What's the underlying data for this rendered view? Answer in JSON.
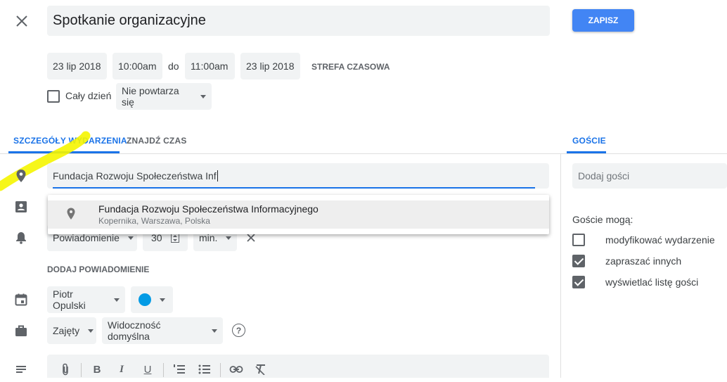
{
  "header": {
    "title_value": "Spotkanie organizacyjne",
    "save_label": "ZAPISZ"
  },
  "datetime": {
    "start_date": "23 lip 2018",
    "start_time": "10:00am",
    "separator": "do",
    "end_time": "11:00am",
    "end_date": "23 lip 2018",
    "timezone_label": "STREFA CZASOWA"
  },
  "options": {
    "all_day_label": "Cały dzień",
    "all_day_checked": false,
    "repeat_value": "Nie powtarza się"
  },
  "tabs": {
    "details": "SZCZEGÓŁY WYDARZENIA",
    "find_time": "ZNAJDŹ CZAS",
    "guests": "GOŚCIE"
  },
  "location": {
    "value": "Fundacja Rozwoju Społeczeństwa Inf",
    "suggestion_title": "Fundacja Rozwoju Społeczeństwa Informacyjnego",
    "suggestion_subtitle": "Kopernika, Warszawa, Polska"
  },
  "notification": {
    "type": "Powiadomienie",
    "amount": "30",
    "unit": "min.",
    "add_label": "DODAJ POWIADOMIENIE"
  },
  "calendar": {
    "owner": "Piotr Opulski",
    "color": "#039be5"
  },
  "availability": {
    "busy": "Zajęty",
    "visibility": "Widoczność domyślna"
  },
  "guests": {
    "add_placeholder": "Dodaj gości",
    "permissions_title": "Goście mogą:",
    "permissions": [
      {
        "label": "modyfikować wydarzenie",
        "checked": false
      },
      {
        "label": "zapraszać innych",
        "checked": true
      },
      {
        "label": "wyświetlać listę gości",
        "checked": true
      }
    ]
  },
  "colors": {
    "accent": "#1a73e8",
    "save_button": "#4285f4",
    "highlight": "#f5f500"
  }
}
